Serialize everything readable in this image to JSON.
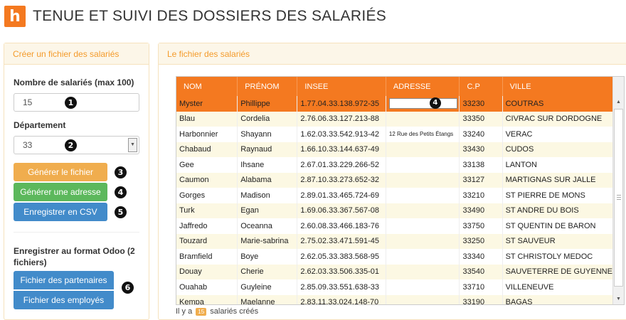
{
  "app": {
    "logo": "h",
    "title": "TENUE ET SUIVI DES DOSSIERS DES SALARIÉS",
    "accent": "#f47920"
  },
  "left": {
    "heading": "Créer un fichier des salariés",
    "count_label": "Nombre de salariés (max 100)",
    "count_value": "15",
    "dept_label": "Département",
    "dept_value": "33",
    "generate_file": "Générer le fichier",
    "generate_address": "Générer une adresse",
    "save_csv": "Enregistrer en CSV",
    "odoo_label": "Enregistrer au format Odoo (2 fichiers)",
    "partners": "Fichier des partenaires",
    "employees": "Fichier des employés",
    "markers": [
      "1",
      "2",
      "3",
      "4",
      "5",
      "6"
    ]
  },
  "right": {
    "heading": "Le fichier des salariés",
    "columns": [
      "NOM",
      "PRÉNOM",
      "INSEE",
      "ADRESSE",
      "C.P",
      "VILLE"
    ],
    "rows": [
      [
        "Myster",
        "Phillippe",
        "1.77.04.33.138.972-35",
        "",
        "33230",
        "COUTRAS"
      ],
      [
        "Blau",
        "Cordelia",
        "2.76.06.33.127.213-88",
        "",
        "33350",
        "CIVRAC SUR DORDOGNE"
      ],
      [
        "Harbonnier",
        "Shayann",
        "1.62.03.33.542.913-42",
        "12 Rue des Petits Étangs",
        "33240",
        "VERAC"
      ],
      [
        "Chabaud",
        "Raynaud",
        "1.66.10.33.144.637-49",
        "",
        "33430",
        "CUDOS"
      ],
      [
        "Gee",
        "Ihsane",
        "2.67.01.33.229.266-52",
        "",
        "33138",
        "LANTON"
      ],
      [
        "Caumon",
        "Alabama",
        "2.87.10.33.273.652-32",
        "",
        "33127",
        "MARTIGNAS SUR JALLE"
      ],
      [
        "Gorges",
        "Madison",
        "2.89.01.33.465.724-69",
        "",
        "33210",
        "ST PIERRE DE MONS"
      ],
      [
        "Turk",
        "Egan",
        "1.69.06.33.367.567-08",
        "",
        "33490",
        "ST ANDRE DU BOIS"
      ],
      [
        "Jaffredo",
        "Oceanna",
        "2.60.08.33.466.183-76",
        "",
        "33750",
        "ST QUENTIN DE BARON"
      ],
      [
        "Touzard",
        "Marie-sabrina",
        "2.75.02.33.471.591-45",
        "",
        "33250",
        "ST SAUVEUR"
      ],
      [
        "Bramfield",
        "Boye",
        "2.62.05.33.383.568-95",
        "",
        "33340",
        "ST CHRISTOLY MEDOC"
      ],
      [
        "Douay",
        "Cherie",
        "2.62.03.33.506.335-01",
        "",
        "33540",
        "SAUVETERRE DE GUYENNE"
      ],
      [
        "Ouahab",
        "Guyleine",
        "2.85.09.33.551.638-33",
        "",
        "33710",
        "VILLENEUVE"
      ],
      [
        "Kempa",
        "Maelanne",
        "2.83.11.33.024.148-70",
        "",
        "33190",
        "BAGAS"
      ]
    ],
    "edit_marker": "4",
    "footer_pre": "Il y a",
    "footer_count": "15",
    "footer_post": "salariés créés"
  }
}
